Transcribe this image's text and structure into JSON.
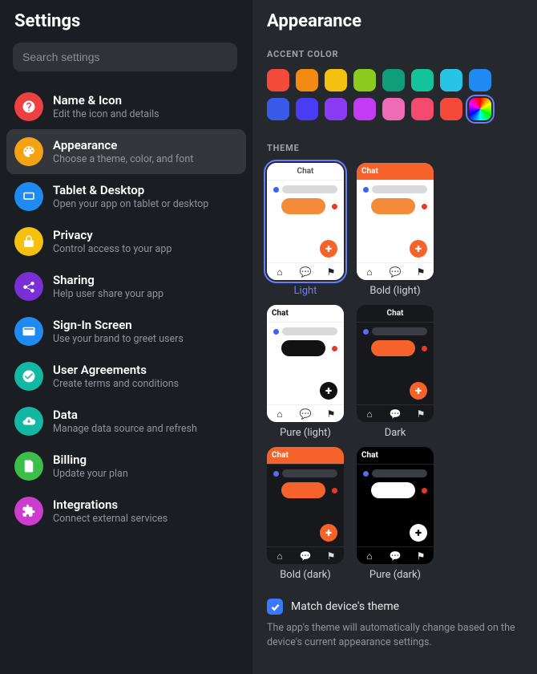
{
  "sidebar": {
    "title": "Settings",
    "search_placeholder": "Search settings",
    "items": [
      {
        "label": "Name & Icon",
        "desc": "Edit the icon and details",
        "icon": "question-icon",
        "color": "#ed4141"
      },
      {
        "label": "Appearance",
        "desc": "Choose a theme, color, and font",
        "icon": "palette-icon",
        "color": "#f5a313"
      },
      {
        "label": "Tablet & Desktop",
        "desc": "Open your app on tablet or desktop",
        "icon": "tablet-icon",
        "color": "#1e8af2"
      },
      {
        "label": "Privacy",
        "desc": "Control access to your app",
        "icon": "lock-icon",
        "color": "#f6c010"
      },
      {
        "label": "Sharing",
        "desc": "Help user share your app",
        "icon": "share-icon",
        "color": "#7a2fd6"
      },
      {
        "label": "Sign-In Screen",
        "desc": "Use your brand to greet users",
        "icon": "card-icon",
        "color": "#1e8af2"
      },
      {
        "label": "User Agreements",
        "desc": "Create terms and conditions",
        "icon": "check-icon",
        "color": "#12b8a4"
      },
      {
        "label": "Data",
        "desc": "Manage data source and refresh",
        "icon": "cloud-icon",
        "color": "#12b8a4"
      },
      {
        "label": "Billing",
        "desc": "Update your plan",
        "icon": "doc-icon",
        "color": "#3dbd4a"
      },
      {
        "label": "Integrations",
        "desc": "Connect external services",
        "icon": "puzzle-icon",
        "color": "#cc3dcf"
      }
    ],
    "active_index": 1
  },
  "main": {
    "title": "Appearance",
    "accent_label": "ACCENT COLOR",
    "accent_colors": [
      "#f44a3b",
      "#f58a13",
      "#f6c010",
      "#8bcb1d",
      "#0f9d7a",
      "#14c29b",
      "#27c4e6",
      "#1e8af2",
      "#3959e8",
      "#4a3bf4",
      "#8a3bf4",
      "#c43bf4",
      "#f06bb5",
      "#f44a6d",
      "#f44a3b",
      "rainbow"
    ],
    "accent_selected_index": 15,
    "theme_label": "THEME",
    "themes": [
      {
        "caption": "Light",
        "variant": "light"
      },
      {
        "caption": "Bold (light)",
        "variant": "bold_light"
      },
      {
        "caption": "Pure (light)",
        "variant": "pure_light"
      },
      {
        "caption": "Dark",
        "variant": "dark"
      },
      {
        "caption": "Bold (dark)",
        "variant": "bold_dark"
      },
      {
        "caption": "Pure (dark)",
        "variant": "pure_dark"
      }
    ],
    "theme_selected_index": 0,
    "theme_header_text": "Chat",
    "match": {
      "checked": true,
      "label": "Match device's theme",
      "desc": "The app's theme will automatically change based on the device's current appearance settings."
    }
  }
}
